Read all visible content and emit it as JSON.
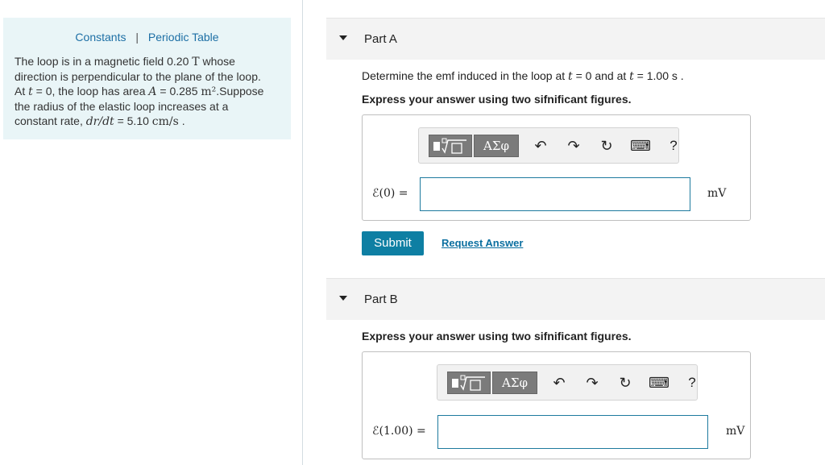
{
  "left_panel": {
    "link_constants": "Constants",
    "separator": "|",
    "link_periodic": "Periodic Table",
    "line1a": "The loop is in a magnetic field 0.20 ",
    "line1_unit": "T",
    "line1b": " whose",
    "line2": "direction is perpendicular to the plane of the loop.",
    "line3a": "At ",
    "line3_var": "t",
    "line3b": " = 0, the loop has area ",
    "line3_var2": "A",
    "line3c": " = 0.285 ",
    "line3_unit": "m²",
    "line3d": ".Suppose",
    "line4": "the radius of the elastic loop increases at a",
    "line5a": "constant rate, ",
    "line5_expr": "dr/dt",
    "line5b": " = 5.10 ",
    "line5_unit": "cm/s",
    "line5c": " ."
  },
  "part_a": {
    "title": "Part A",
    "question_a": "Determine the emf induced in the loop at ",
    "question_var1": "t",
    "question_b": " = 0 and at ",
    "question_var2": "t",
    "question_c": " = 1.00 s .",
    "instruction": "Express your answer using two sifnificant figures.",
    "toolbar": {
      "greek_label": "ΑΣφ",
      "undo": "↶",
      "redo": "↷",
      "reset": "↻",
      "keyboard": "⌨",
      "help": "?"
    },
    "eq_label": "ℰ(0) =",
    "input_value": "",
    "unit": "mV",
    "submit_label": "Submit",
    "request_label": "Request Answer"
  },
  "part_b": {
    "title": "Part B",
    "instruction": "Express your answer using two sifnificant figures.",
    "toolbar": {
      "greek_label": "ΑΣφ",
      "undo": "↶",
      "redo": "↷",
      "reset": "↻",
      "keyboard": "⌨",
      "help": "?"
    },
    "eq_label": "ℰ(1.00) =",
    "input_value": "",
    "unit": "mV"
  }
}
